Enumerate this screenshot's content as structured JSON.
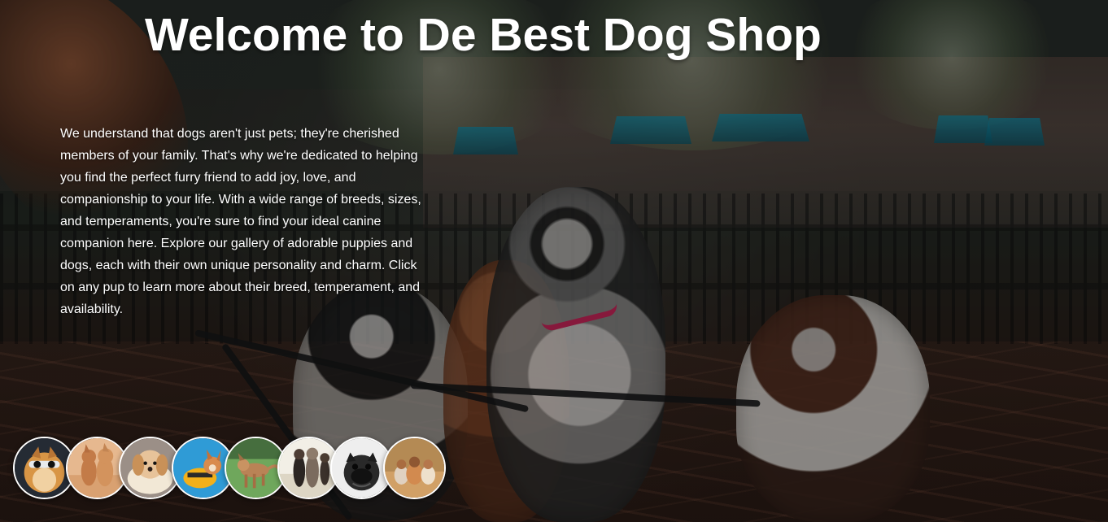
{
  "hero": {
    "title": "Welcome to De Best Dog Shop",
    "description": "We understand that dogs aren't just pets; they're cherished members of your family. That's why we're dedicated to helping you find the perfect furry friend to add joy, love, and companionship to your life. With a wide range of breeds, sizes, and temperaments, you're sure to find your ideal canine companion here. Explore our gallery of adorable puppies and dogs, each with their own unique personality and charm. Click on any pup to learn more about their breed, temperament, and availability."
  },
  "gallery": {
    "items": [
      {
        "icon": "dog-with-sunglasses-photo"
      },
      {
        "icon": "two-small-dogs-photo"
      },
      {
        "icon": "golden-puppy-photo"
      },
      {
        "icon": "corgi-in-yellow-coat-photo"
      },
      {
        "icon": "running-dog-on-grass-photo"
      },
      {
        "icon": "dogs-standing-photo"
      },
      {
        "icon": "pug-photo"
      },
      {
        "icon": "small-dogs-group-photo"
      }
    ]
  },
  "colors": {
    "title_text": "#ffffff",
    "body_text": "#ffffff",
    "collar_pink": "#d2285e",
    "awning_teal": "#1495b3"
  }
}
